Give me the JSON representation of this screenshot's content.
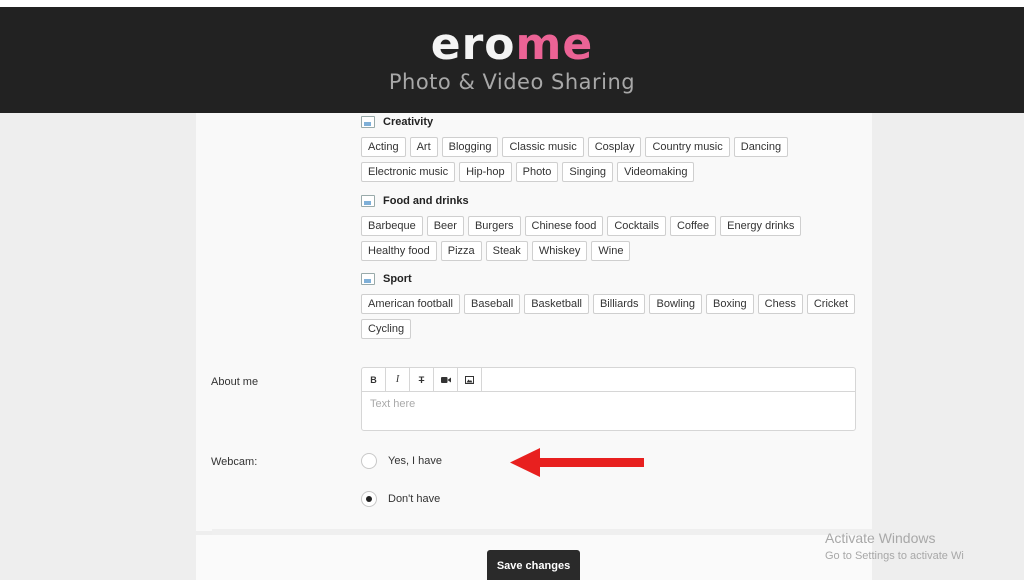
{
  "header": {
    "logo_white": "ero",
    "logo_pink": "me",
    "tagline": "Photo & Video Sharing"
  },
  "colors": {
    "accent": "#eb6395",
    "header_bg": "#222222",
    "arrow": "#e8201f",
    "button_bg": "#2a2a2a"
  },
  "interests": [
    {
      "title": "Creativity",
      "tags": [
        "Acting",
        "Art",
        "Blogging",
        "Classic music",
        "Cosplay",
        "Country music",
        "Dancing",
        "Electronic music",
        "Hip-hop",
        "Photo",
        "Singing",
        "Videomaking"
      ]
    },
    {
      "title": "Food and drinks",
      "tags": [
        "Barbeque",
        "Beer",
        "Burgers",
        "Chinese food",
        "Cocktails",
        "Coffee",
        "Energy drinks",
        "Healthy food",
        "Pizza",
        "Steak",
        "Whiskey",
        "Wine"
      ]
    },
    {
      "title": "Sport",
      "tags": [
        "American football",
        "Baseball",
        "Basketball",
        "Billiards",
        "Bowling",
        "Boxing",
        "Chess",
        "Cricket",
        "Cycling"
      ]
    }
  ],
  "about": {
    "label": "About me",
    "placeholder": "Text here",
    "toolbar": {
      "bold": "B",
      "italic": "I",
      "strike": "T"
    }
  },
  "webcam": {
    "label": "Webcam:",
    "options": [
      {
        "label": "Yes, I have",
        "checked": false
      },
      {
        "label": "Don't have",
        "checked": true
      }
    ]
  },
  "save_label": "Save changes",
  "windows_watermark": {
    "title": "Activate Windows",
    "subtitle": "Go to Settings to activate Wi"
  }
}
